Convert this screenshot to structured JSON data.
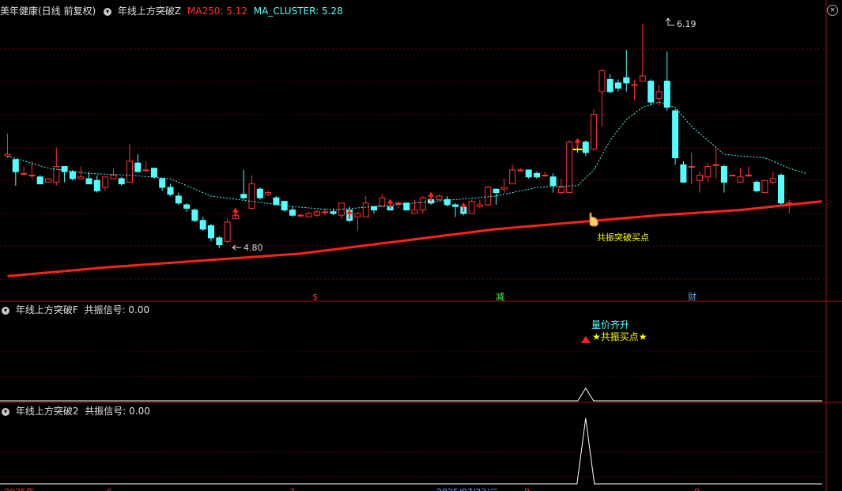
{
  "main": {
    "stock_title": "美年健康(日线 前复权)",
    "indicator_name": "年线上方突破Z",
    "ma250_label": "MA250: 5.12",
    "cluster_label": "MA_CLUSTER: 5.28",
    "high_label": "6.19",
    "low_label": "4.80",
    "signal_text": "共振突破买点",
    "markers": [
      "$",
      "减",
      "财"
    ],
    "colors": {
      "up": "#ff3232",
      "down": "#54ffff",
      "ma250": "#ff2020",
      "cluster": "#54ffff",
      "signal_bar": "#ffff00"
    }
  },
  "sub1": {
    "indicator_name": "年线上方突破F",
    "signal_label": "共振信号: 0.00",
    "text_top": "量价齐升",
    "text_bottom": "★共振买点★"
  },
  "sub2": {
    "indicator_name": "年线上方突破2",
    "signal_label": "共振信号: 0.00"
  },
  "timeline": {
    "labels": [
      "2025年",
      "6",
      "7",
      "2025/07/22/二",
      "8",
      "9"
    ]
  },
  "chart_data": {
    "type": "candlestick",
    "candles": [
      {
        "o": 5.43,
        "c": 5.44,
        "h": 5.56,
        "l": 5.42
      },
      {
        "o": 5.41,
        "c": 5.34,
        "h": 5.41,
        "l": 5.26
      },
      {
        "o": 5.33,
        "c": 5.33,
        "h": 5.37,
        "l": 5.32
      },
      {
        "o": 5.32,
        "c": 5.32,
        "h": 5.4,
        "l": 5.3
      },
      {
        "o": 5.31,
        "c": 5.27,
        "h": 5.32,
        "l": 5.27
      },
      {
        "o": 5.28,
        "c": 5.3,
        "h": 5.3,
        "l": 5.28
      },
      {
        "o": 5.28,
        "c": 5.37,
        "h": 5.48,
        "l": 5.26
      },
      {
        "o": 5.37,
        "c": 5.34,
        "h": 5.37,
        "l": 5.28
      },
      {
        "o": 5.34,
        "c": 5.3,
        "h": 5.35,
        "l": 5.29
      },
      {
        "o": 5.3,
        "c": 5.31,
        "h": 5.37,
        "l": 5.3
      },
      {
        "o": 5.3,
        "c": 5.27,
        "h": 5.34,
        "l": 5.27
      },
      {
        "o": 5.29,
        "c": 5.23,
        "h": 5.32,
        "l": 5.22
      },
      {
        "o": 5.25,
        "c": 5.31,
        "h": 5.31,
        "l": 5.23
      },
      {
        "o": 5.3,
        "c": 5.32,
        "h": 5.36,
        "l": 5.3
      },
      {
        "o": 5.3,
        "c": 5.27,
        "h": 5.31,
        "l": 5.26
      },
      {
        "o": 5.28,
        "c": 5.4,
        "h": 5.5,
        "l": 5.28
      },
      {
        "o": 5.39,
        "c": 5.34,
        "h": 5.44,
        "l": 5.34
      },
      {
        "o": 5.35,
        "c": 5.35,
        "h": 5.4,
        "l": 5.34
      },
      {
        "o": 5.36,
        "c": 5.31,
        "h": 5.36,
        "l": 5.3
      },
      {
        "o": 5.3,
        "c": 5.25,
        "h": 5.3,
        "l": 5.23
      },
      {
        "o": 5.25,
        "c": 5.21,
        "h": 5.27,
        "l": 5.2
      },
      {
        "o": 5.2,
        "c": 5.16,
        "h": 5.22,
        "l": 5.15
      },
      {
        "o": 5.15,
        "c": 5.13,
        "h": 5.16,
        "l": 5.11
      },
      {
        "o": 5.12,
        "c": 5.06,
        "h": 5.13,
        "l": 5.05
      },
      {
        "o": 5.06,
        "c": 5.01,
        "h": 5.08,
        "l": 5.0
      },
      {
        "o": 5.03,
        "c": 4.96,
        "h": 5.04,
        "l": 4.94
      },
      {
        "o": 4.96,
        "c": 4.92,
        "h": 4.97,
        "l": 4.9
      },
      {
        "o": 4.94,
        "c": 5.05,
        "h": 5.07,
        "l": 4.93
      },
      {
        "o": 5.07,
        "c": 5.09,
        "h": 5.12,
        "l": 5.07
      },
      {
        "o": 5.21,
        "c": 5.19,
        "h": 5.35,
        "l": 5.18
      },
      {
        "o": 5.13,
        "c": 5.27,
        "h": 5.32,
        "l": 5.12
      },
      {
        "o": 5.24,
        "c": 5.19,
        "h": 5.25,
        "l": 5.18
      },
      {
        "o": 5.21,
        "c": 5.22,
        "h": 5.23,
        "l": 5.2
      },
      {
        "o": 5.19,
        "c": 5.15,
        "h": 5.2,
        "l": 5.15
      },
      {
        "o": 5.17,
        "c": 5.12,
        "h": 5.17,
        "l": 5.11
      },
      {
        "o": 5.12,
        "c": 5.09,
        "h": 5.14,
        "l": 5.08
      },
      {
        "o": 5.09,
        "c": 5.09,
        "h": 5.1,
        "l": 5.08
      },
      {
        "o": 5.08,
        "c": 5.1,
        "h": 5.11,
        "l": 5.08
      },
      {
        "o": 5.09,
        "c": 5.11,
        "h": 5.12,
        "l": 5.08
      },
      {
        "o": 5.11,
        "c": 5.11,
        "h": 5.13,
        "l": 5.09
      },
      {
        "o": 5.11,
        "c": 5.1,
        "h": 5.13,
        "l": 5.09
      },
      {
        "o": 5.09,
        "c": 5.16,
        "h": 5.16,
        "l": 5.07
      },
      {
        "o": 5.12,
        "c": 5.06,
        "h": 5.14,
        "l": 5.05
      },
      {
        "o": 5.08,
        "c": 5.1,
        "h": 5.11,
        "l": 5.0
      },
      {
        "o": 5.08,
        "c": 5.16,
        "h": 5.2,
        "l": 5.08
      },
      {
        "o": 5.14,
        "c": 5.12,
        "h": 5.14,
        "l": 5.1
      },
      {
        "o": 5.14,
        "c": 5.19,
        "h": 5.21,
        "l": 5.14
      },
      {
        "o": 5.14,
        "c": 5.12,
        "h": 5.14,
        "l": 5.12
      },
      {
        "o": 5.16,
        "c": 5.16,
        "h": 5.17,
        "l": 5.13
      },
      {
        "o": 5.16,
        "c": 5.12,
        "h": 5.16,
        "l": 5.12
      },
      {
        "o": 5.1,
        "c": 5.12,
        "h": 5.18,
        "l": 5.1
      },
      {
        "o": 5.12,
        "c": 5.19,
        "h": 5.2,
        "l": 5.1
      },
      {
        "o": 5.18,
        "c": 5.16,
        "h": 5.21,
        "l": 5.15
      },
      {
        "o": 5.18,
        "c": 5.2,
        "h": 5.21,
        "l": 5.17
      },
      {
        "o": 5.18,
        "c": 5.15,
        "h": 5.2,
        "l": 5.14
      },
      {
        "o": 5.15,
        "c": 5.14,
        "h": 5.16,
        "l": 5.08
      },
      {
        "o": 5.14,
        "c": 5.1,
        "h": 5.15,
        "l": 5.09
      },
      {
        "o": 5.1,
        "c": 5.17,
        "h": 5.18,
        "l": 5.1
      },
      {
        "o": 5.14,
        "c": 5.15,
        "h": 5.18,
        "l": 5.13
      },
      {
        "o": 5.15,
        "c": 5.25,
        "h": 5.26,
        "l": 5.14
      },
      {
        "o": 5.24,
        "c": 5.22,
        "h": 5.24,
        "l": 5.15
      },
      {
        "o": 5.24,
        "c": 5.25,
        "h": 5.3,
        "l": 5.22
      },
      {
        "o": 5.27,
        "c": 5.35,
        "h": 5.38,
        "l": 5.27
      },
      {
        "o": 5.35,
        "c": 5.35,
        "h": 5.36,
        "l": 5.34
      },
      {
        "o": 5.35,
        "c": 5.31,
        "h": 5.35,
        "l": 5.3
      },
      {
        "o": 5.33,
        "c": 5.31,
        "h": 5.34,
        "l": 5.3
      },
      {
        "o": 5.32,
        "c": 5.32,
        "h": 5.34,
        "l": 5.31
      },
      {
        "o": 5.31,
        "c": 5.26,
        "h": 5.33,
        "l": 5.22
      },
      {
        "o": 5.22,
        "c": 5.25,
        "h": 5.3,
        "l": 5.21
      },
      {
        "o": 5.22,
        "c": 5.51,
        "h": 5.52,
        "l": 5.22
      },
      {
        "o": 5.47,
        "c": 5.47,
        "h": 5.49,
        "l": 5.45
      },
      {
        "o": 5.51,
        "c": 5.45,
        "h": 5.52,
        "l": 5.43
      },
      {
        "o": 5.47,
        "c": 5.67,
        "h": 5.7,
        "l": 5.46
      },
      {
        "o": 5.8,
        "c": 5.92,
        "h": 5.93,
        "l": 5.6
      },
      {
        "o": 5.87,
        "c": 5.8,
        "h": 5.9,
        "l": 5.79
      },
      {
        "o": 5.85,
        "c": 5.82,
        "h": 5.87,
        "l": 5.8
      },
      {
        "o": 5.88,
        "c": 5.85,
        "h": 6.04,
        "l": 5.8
      },
      {
        "o": 5.84,
        "c": 5.84,
        "h": 5.87,
        "l": 5.75
      },
      {
        "o": 5.86,
        "c": 5.89,
        "h": 6.19,
        "l": 5.88
      },
      {
        "o": 5.86,
        "c": 5.74,
        "h": 5.87,
        "l": 5.72
      },
      {
        "o": 5.76,
        "c": 5.8,
        "h": 5.84,
        "l": 5.72
      },
      {
        "o": 5.86,
        "c": 5.71,
        "h": 6.03,
        "l": 5.69
      },
      {
        "o": 5.69,
        "c": 5.42,
        "h": 5.7,
        "l": 5.38
      },
      {
        "o": 5.38,
        "c": 5.28,
        "h": 5.4,
        "l": 5.28
      },
      {
        "o": 5.37,
        "c": 5.37,
        "h": 5.45,
        "l": 5.27
      },
      {
        "o": 5.29,
        "c": 5.32,
        "h": 5.34,
        "l": 5.22
      },
      {
        "o": 5.31,
        "c": 5.37,
        "h": 5.39,
        "l": 5.28
      },
      {
        "o": 5.38,
        "c": 5.38,
        "h": 5.48,
        "l": 5.3
      },
      {
        "o": 5.37,
        "c": 5.28,
        "h": 5.38,
        "l": 5.22
      },
      {
        "o": 5.32,
        "c": 5.32,
        "h": 5.32,
        "l": 5.32
      },
      {
        "o": 5.28,
        "c": 5.31,
        "h": 5.36,
        "l": 5.28
      },
      {
        "o": 5.32,
        "c": 5.32,
        "h": 5.37,
        "l": 5.31
      },
      {
        "o": 5.28,
        "c": 5.23,
        "h": 5.29,
        "l": 5.22
      },
      {
        "o": 5.22,
        "c": 5.29,
        "h": 5.29,
        "l": 5.22
      },
      {
        "o": 5.28,
        "c": 5.3,
        "h": 5.34,
        "l": 5.27
      },
      {
        "o": 5.32,
        "c": 5.16,
        "h": 5.33,
        "l": 5.15
      },
      {
        "o": 5.16,
        "c": 5.16,
        "h": 5.18,
        "l": 5.1
      }
    ],
    "signal_candle_index": 70,
    "buy_arrow_indices": [
      28,
      42,
      47,
      52,
      56,
      70
    ],
    "ma_cluster": [
      [
        0,
        5.43
      ],
      [
        5,
        5.36
      ],
      [
        10,
        5.33
      ],
      [
        15,
        5.32
      ],
      [
        20,
        5.3
      ],
      [
        25,
        5.2
      ],
      [
        30,
        5.17
      ],
      [
        35,
        5.14
      ],
      [
        40,
        5.12
      ],
      [
        45,
        5.14
      ],
      [
        50,
        5.16
      ],
      [
        55,
        5.18
      ],
      [
        60,
        5.2
      ],
      [
        65,
        5.25
      ],
      [
        70,
        5.26
      ],
      [
        72,
        5.35
      ],
      [
        74,
        5.52
      ],
      [
        76,
        5.64
      ],
      [
        78,
        5.71
      ],
      [
        80,
        5.74
      ],
      [
        82,
        5.71
      ],
      [
        84,
        5.6
      ],
      [
        86,
        5.52
      ],
      [
        88,
        5.44
      ],
      [
        90,
        5.43
      ],
      [
        93,
        5.42
      ],
      [
        96,
        5.36
      ],
      [
        98,
        5.33
      ]
    ],
    "ma250": [
      [
        0,
        4.74
      ],
      [
        12,
        4.79
      ],
      [
        24,
        4.83
      ],
      [
        36,
        4.87
      ],
      [
        48,
        4.94
      ],
      [
        60,
        5.01
      ],
      [
        70,
        5.05
      ],
      [
        80,
        5.09
      ],
      [
        90,
        5.12
      ],
      [
        100,
        5.17
      ]
    ],
    "sub1_peak_index": 71,
    "sub2_peak_index": 71
  }
}
